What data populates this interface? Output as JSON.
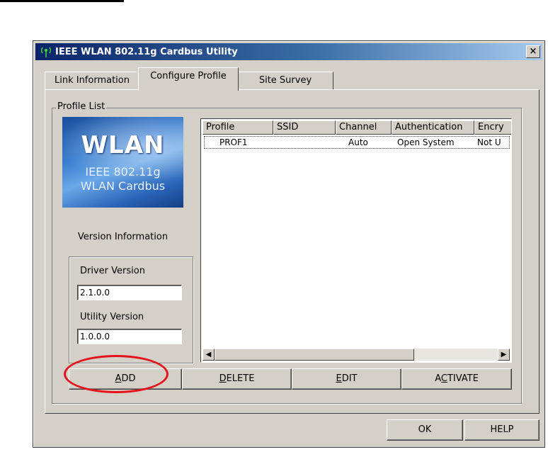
{
  "window": {
    "title": "IEEE WLAN 802.11g Cardbus Utility",
    "close_label": "×"
  },
  "tabs": [
    {
      "label": "Link Information",
      "active": false
    },
    {
      "label": "Configure Profile",
      "active": true
    },
    {
      "label": "Site Survey",
      "active": false
    }
  ],
  "profile_list": {
    "legend": "Profile List",
    "columns": [
      "Profile",
      "SSID",
      "Channel",
      "Authentication",
      "Encry"
    ],
    "rows": [
      {
        "profile": "PROF1",
        "ssid": "",
        "channel": "Auto",
        "authentication": "Open System",
        "encryption": "Not U"
      }
    ]
  },
  "logo": {
    "line1": "WLAN",
    "line2": "IEEE 802.11g",
    "line3": "WLAN Cardbus"
  },
  "version": {
    "heading": "Version Information",
    "driver_label": "Driver Version",
    "driver_value": "2.1.0.0",
    "utility_label": "Utility Version",
    "utility_value": "1.0.0.0"
  },
  "profile_buttons": {
    "add": {
      "pre": "",
      "key": "A",
      "post": "DD"
    },
    "delete": {
      "pre": "",
      "key": "D",
      "post": "ELETE"
    },
    "edit": {
      "pre": "",
      "key": "E",
      "post": "DIT"
    },
    "activate": {
      "pre": "A",
      "key": "C",
      "post": "TIVATE"
    }
  },
  "dialog_buttons": {
    "ok": "OK",
    "help": "HELP"
  },
  "colors": {
    "face": "#d4d0c8",
    "title_start": "#0a246a",
    "highlight_ring": "#e3141b"
  }
}
